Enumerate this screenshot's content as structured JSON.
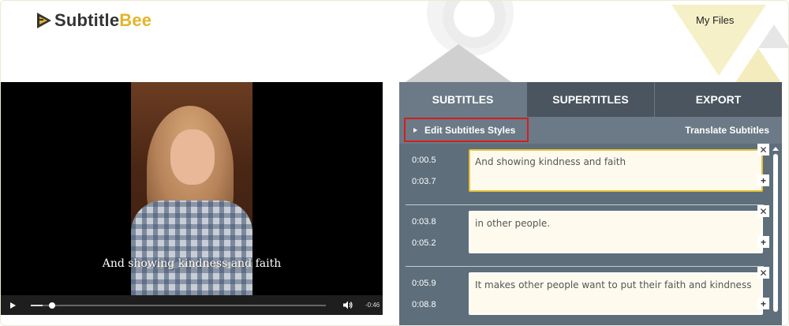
{
  "header": {
    "logo_part1": "Subtitle",
    "logo_part2": "Bee",
    "nav_my_files": "My Files"
  },
  "video": {
    "caption": "And showing kindness and faith",
    "time_remaining": "-0:46",
    "progress_fraction": 0.04
  },
  "panel": {
    "tabs": [
      {
        "label": "SUBTITLES",
        "active": true
      },
      {
        "label": "SUPERTITLES",
        "active": false
      },
      {
        "label": "EXPORT",
        "active": false
      }
    ],
    "edit_styles_label": "Edit Subtitles Styles",
    "translate_label": "Translate Subtitles",
    "subtitles": [
      {
        "start": "0:00.5",
        "end": "0:03.7",
        "text": "And showing kindness and faith"
      },
      {
        "start": "0:03.8",
        "end": "0:05.2",
        "text": "in other people."
      },
      {
        "start": "0:05.9",
        "end": "0:08.8",
        "text": "It makes other people want to put their faith and kindness"
      }
    ],
    "delete_symbol": "✕",
    "add_symbol": "+"
  },
  "colors": {
    "brand_yellow": "#e4b42a",
    "panel_bg": "#5e6e7b",
    "highlight_red": "#d21f1f",
    "focus_yellow": "#e7c23a"
  }
}
